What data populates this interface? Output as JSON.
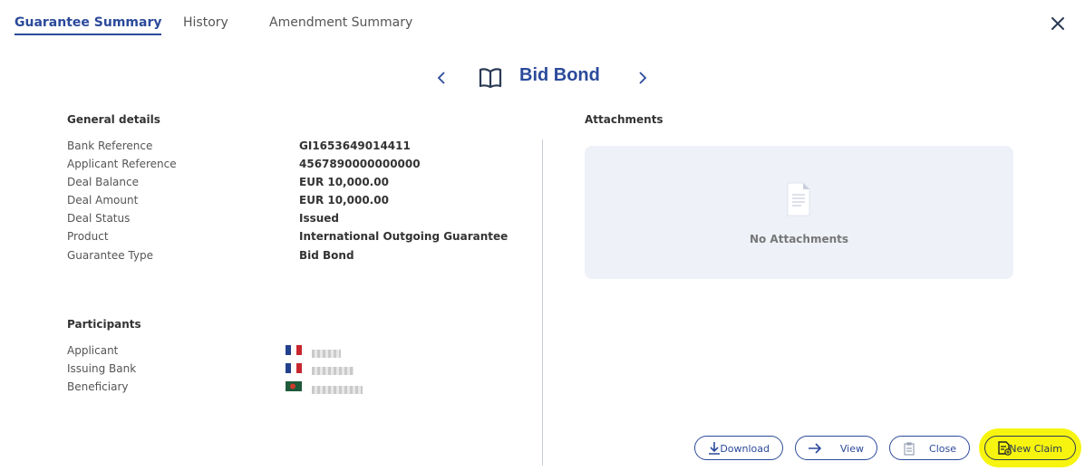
{
  "tabs": [
    {
      "label": "Guarantee Summary",
      "active": true
    },
    {
      "label": "History",
      "active": false
    },
    {
      "label": "Amendment Summary",
      "active": false
    }
  ],
  "title": "Bid Bond",
  "general": {
    "heading": "General details",
    "rows": [
      {
        "label": "Bank Reference",
        "value": "GI1653649014411"
      },
      {
        "label": "Applicant Reference",
        "value": "4567890000000000"
      },
      {
        "label": "Deal Balance",
        "value": "EUR 10,000.00"
      },
      {
        "label": "Deal Amount",
        "value": "EUR 10,000.00"
      },
      {
        "label": "Deal Status",
        "value": "Issued"
      },
      {
        "label": "Product",
        "value": "International Outgoing Guarantee"
      },
      {
        "label": "Guarantee Type",
        "value": "Bid Bond"
      }
    ]
  },
  "participants": {
    "heading": "Participants",
    "rows": [
      {
        "label": "Applicant",
        "flag": "fr"
      },
      {
        "label": "Issuing Bank",
        "flag": "fr"
      },
      {
        "label": "Beneficiary",
        "flag": "bd"
      }
    ]
  },
  "attachments": {
    "heading": "Attachments",
    "empty_text": "No Attachments"
  },
  "buttons": {
    "download": "Download",
    "view": "View",
    "close": "Close",
    "new_claim": "New Claim"
  },
  "colors": {
    "accent": "#2b4a9b",
    "highlight": "#f7f50f",
    "attach_bg": "#eef1f8"
  }
}
